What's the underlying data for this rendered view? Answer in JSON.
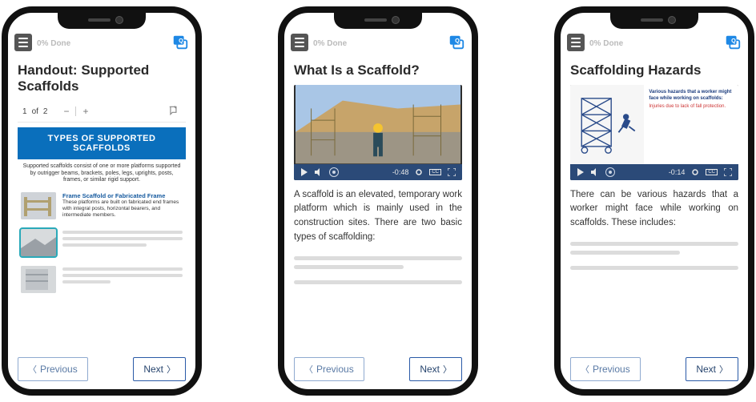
{
  "common": {
    "progress_text": "0% Done",
    "prev_label": "Previous",
    "next_label": "Next"
  },
  "phone1": {
    "title": "Handout: Supported Scaffolds",
    "doc": {
      "page_current": "1",
      "of_label": "of",
      "page_total": "2",
      "banner": "TYPES OF SUPPORTED SCAFFOLDS",
      "subtext": "Supported scaffolds consist of one or more platforms supported by outrigger beams, brackets, poles, legs, uprights, posts, frames, or similar rigid support.",
      "items": [
        {
          "title": "Frame Scaffold or Fabricated Frame",
          "desc": "These platforms are built on fabricated end frames with integral posts, horizontal bearers, and intermediate members."
        },
        {
          "title": "",
          "desc": ""
        },
        {
          "title": "",
          "desc": ""
        }
      ]
    }
  },
  "phone2": {
    "title": "What Is a Scaffold?",
    "video": {
      "time": "-0:48"
    },
    "body": "A scaffold is an elevated, temporary work platform which is mainly used in the construction sites. There are two basic types of scaffolding:"
  },
  "phone3": {
    "title": "Scaffolding Hazards",
    "video": {
      "time": "-0:14"
    },
    "slide": {
      "heading": "Various hazards that a worker might face while working on scaffolds:",
      "bullet1": "Injuries due to lack of fall protection."
    },
    "body": "There can be various hazards that a worker might face while working on scaffolds. These includes:"
  }
}
